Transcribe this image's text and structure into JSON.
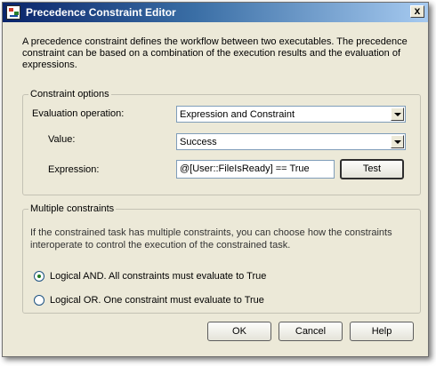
{
  "window": {
    "title": "Precedence Constraint Editor",
    "close_glyph": "x"
  },
  "description": "A precedence constraint defines the workflow between two executables. The precedence constraint can be based on a combination of the execution results and the evaluation of expressions.",
  "constraint_options": {
    "legend": "Constraint options",
    "evaluation_operation": {
      "label": "Evaluation operation:",
      "value": "Expression and Constraint"
    },
    "value": {
      "label": "Value:",
      "value": "Success"
    },
    "expression": {
      "label": "Expression:",
      "value": "@[User::FileIsReady] == True"
    },
    "test_button": "Test"
  },
  "multiple_constraints": {
    "legend": "Multiple constraints",
    "description": "If the constrained task has multiple constraints, you can choose how the constraints interoperate to control the execution of the constrained task.",
    "options": [
      {
        "label": "Logical AND. All constraints must evaluate to True",
        "checked": true
      },
      {
        "label": "Logical OR. One constraint must evaluate to True",
        "checked": false
      }
    ]
  },
  "buttons": {
    "ok": "OK",
    "cancel": "Cancel",
    "help": "Help"
  },
  "colors": {
    "title_gradient_start": "#0a246a",
    "dialog_bg": "#ece9d8",
    "radio_dot": "#1f7a1f"
  }
}
